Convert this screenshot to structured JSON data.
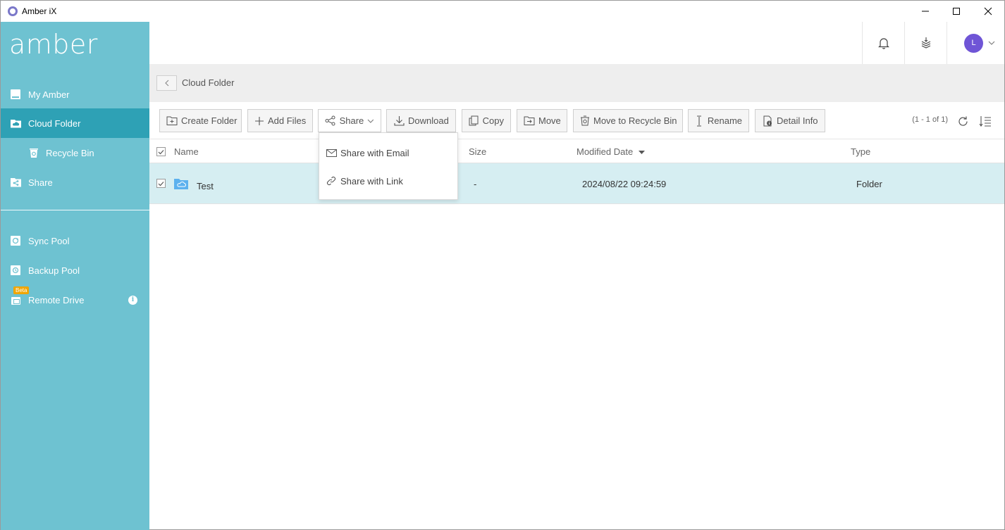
{
  "window": {
    "title": "Amber iX"
  },
  "sidebar": {
    "logo": "amber",
    "items": [
      {
        "label": "My Amber",
        "icon": "drive-icon"
      },
      {
        "label": "Cloud Folder",
        "icon": "cloud-folder-icon",
        "active": true
      },
      {
        "label": "Recycle Bin",
        "icon": "recycle-bin-icon"
      },
      {
        "label": "Share",
        "icon": "share-folder-icon"
      },
      {
        "label": "Sync Pool",
        "icon": "sync-pool-icon"
      },
      {
        "label": "Backup Pool",
        "icon": "backup-pool-icon"
      },
      {
        "label": "Remote Drive",
        "icon": "remote-drive-icon",
        "badge": "Beta"
      }
    ],
    "info_glyph": "i"
  },
  "header": {
    "avatar_initial": "L"
  },
  "breadcrumb": {
    "current": "Cloud Folder"
  },
  "toolbar": {
    "create_folder": "Create Folder",
    "add_files": "Add Files",
    "share": "Share",
    "download": "Download",
    "copy": "Copy",
    "move": "Move",
    "move_to_recycle_bin": "Move to Recycle Bin",
    "rename": "Rename",
    "detail_info": "Detail Info",
    "pager": "(1 - 1 of 1)"
  },
  "share_menu": {
    "email": "Share with Email",
    "link": "Share with Link"
  },
  "table": {
    "columns": {
      "name": "Name",
      "size": "Size",
      "modified": "Modified Date",
      "type": "Type"
    },
    "rows": [
      {
        "name": "Test",
        "size": "-",
        "modified": "2024/08/22 09:24:59",
        "type": "Folder",
        "selected": true
      }
    ]
  },
  "colors": {
    "sidebar": "#6ec2d1",
    "sidebar_active": "#2ea1b5",
    "row_selected": "#d6eef2",
    "avatar": "#6f55d6",
    "beta": "#f0a500"
  }
}
